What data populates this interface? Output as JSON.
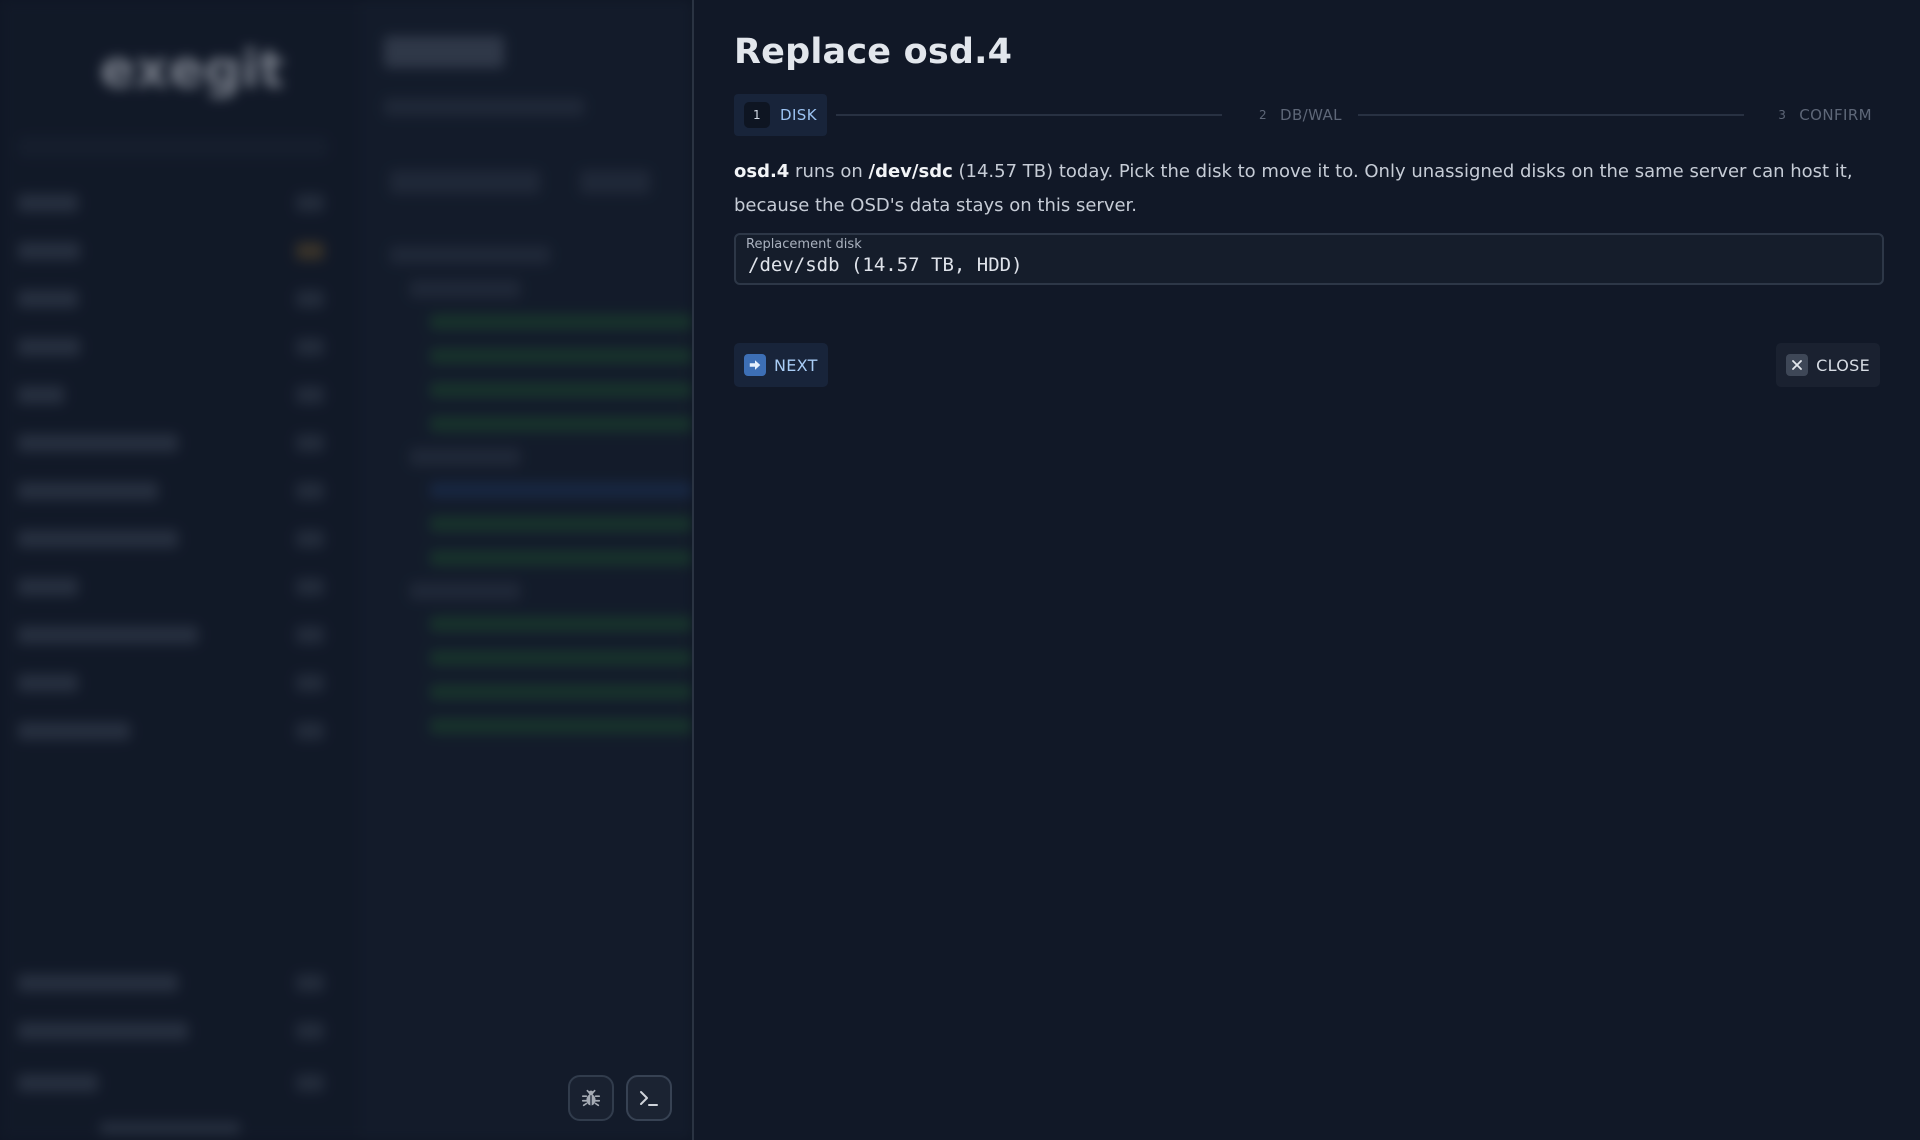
{
  "background": {
    "logo_text": "exegit"
  },
  "drawer": {
    "title": "Replace osd.4",
    "steps": [
      {
        "number": "1",
        "label": "DISK",
        "state": "active"
      },
      {
        "number": "2",
        "label": "DB/WAL",
        "state": "inactive"
      },
      {
        "number": "3",
        "label": "CONFIRM",
        "state": "inactive"
      }
    ],
    "description": {
      "osd": "osd.4",
      "runs_on": " runs on ",
      "device": "/dev/sdc",
      "rest": " (14.57 TB) today. Pick the disk to move it to. Only unassigned disks on the same server can host it, because the OSD's data stays on this server."
    },
    "replacement_field": {
      "label": "Replacement disk",
      "value": "/dev/sdb (14.57 TB, HDD)"
    },
    "next_label": "NEXT",
    "close_label": "CLOSE"
  },
  "icons": {
    "next": "arrow-right-icon",
    "close": "close-icon",
    "debug": "bug-icon",
    "terminal": "terminal-icon"
  },
  "colors": {
    "accent": "#9cc3f2",
    "drawer_bg": "#111827",
    "next_icon_bg": "#3d6fb5"
  }
}
